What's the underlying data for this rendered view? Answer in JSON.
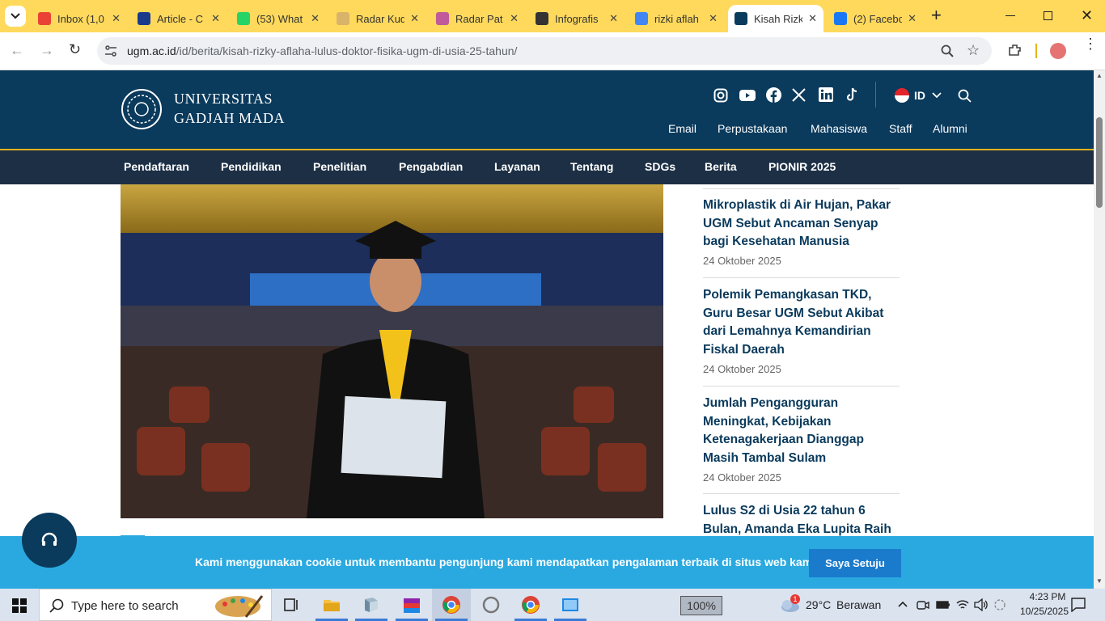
{
  "browser": {
    "tabs": [
      {
        "title": "Inbox (1,0",
        "favicon": "gmail-icon",
        "color": "#ea4335"
      },
      {
        "title": "Article - C",
        "favicon": "ro-icon",
        "color": "#1a3b8c"
      },
      {
        "title": "(53) What",
        "favicon": "whatsapp-icon",
        "color": "#25d366"
      },
      {
        "title": "Radar Kud",
        "favicon": "radar-icon",
        "color": "#d9b36a"
      },
      {
        "title": "Radar Pat",
        "favicon": "radar-pati-icon",
        "color": "#c05a9a"
      },
      {
        "title": "Infografis",
        "favicon": "openai-icon",
        "color": "#333333"
      },
      {
        "title": "rizki aflah",
        "favicon": "google-icon",
        "color": "#4285f4"
      },
      {
        "title": "Kisah Rizk",
        "favicon": "ugm-icon",
        "color": "#0a3a5c",
        "active": true
      },
      {
        "title": "(2) Facebo",
        "favicon": "facebook-icon",
        "color": "#1877f2"
      }
    ],
    "url_domain": "ugm.ac.id",
    "url_path": "/id/berita/kisah-rizky-aflaha-lulus-doktor-fisika-ugm-di-usia-25-tahun/"
  },
  "site": {
    "logo_line1": "UNIVERSITAS",
    "logo_line2": "GADJAH MADA",
    "language": "ID",
    "top_links": [
      "Email",
      "Perpustakaan",
      "Mahasiswa",
      "Staff",
      "Alumni"
    ],
    "nav": [
      "Pendaftaran",
      "Pendidikan",
      "Penelitian",
      "Pengabdian",
      "Layanan",
      "Tentang",
      "SDGs",
      "Berita",
      "PIONIR 2025"
    ],
    "colors": {
      "header": "#0a3a5c",
      "nav": "#1c2f45",
      "accent": "#e8b21d",
      "cookie": "#2aa9e0"
    }
  },
  "sidebar": [
    {
      "title": "Mikroplastik di Air Hujan, Pakar UGM Sebut Ancaman Senyap bagi Kesehatan Manusia",
      "date": "24 Oktober 2025"
    },
    {
      "title": "Polemik Pemangkasan TKD, Guru Besar UGM Sebut Akibat dari Lemahnya Kemandirian Fiskal Daerah",
      "date": "24 Oktober 2025"
    },
    {
      "title": "Jumlah Pengangguran Meningkat, Kebijakan Ketenagakerjaan Dianggap Masih Tambal Sulam",
      "date": "24 Oktober 2025"
    },
    {
      "title": "Lulus S2 di Usia 22 tahun 6 Bulan, Amanda Eka Lupita Raih",
      "date": ""
    }
  ],
  "cookie": {
    "text": "Kami menggunakan cookie untuk membantu pengunjung kami mendapatkan pengalaman terbaik di situs web kami.",
    "button": "Saya Setuju"
  },
  "taskbar": {
    "search_placeholder": "Type here to search",
    "zoom": "100%",
    "weather_temp": "29°C",
    "weather_desc": "Berawan",
    "weather_badge": "1",
    "time": "4:23 PM",
    "date": "10/25/2025"
  }
}
